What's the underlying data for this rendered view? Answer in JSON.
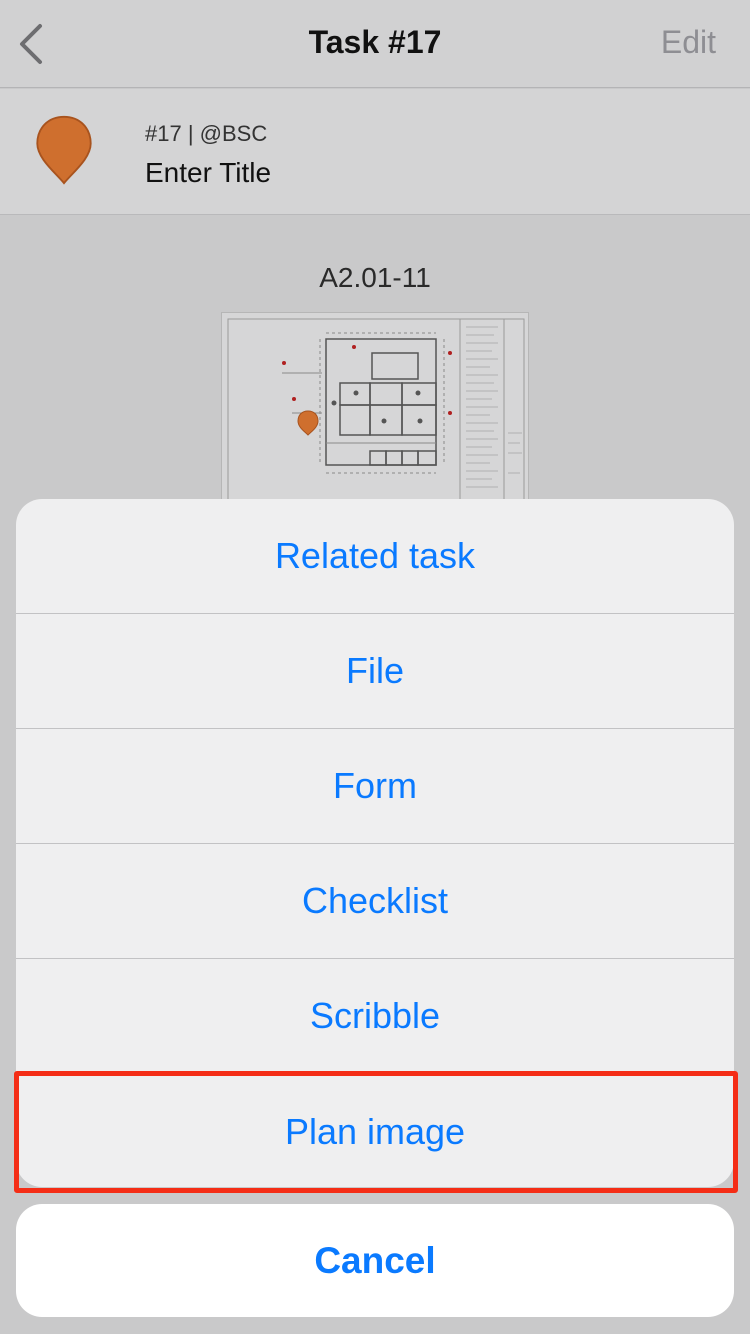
{
  "nav": {
    "back_icon": "chevron-left-icon",
    "title": "Task #17",
    "edit_label": "Edit"
  },
  "task": {
    "pin_icon": "map-pin-icon",
    "pin_color": "#cf6f2e",
    "meta": "#17 | @BSC",
    "title": "Enter Title"
  },
  "plan": {
    "label": "A2.01-11",
    "thumbnail": "floor-plan-drawing"
  },
  "action_sheet": {
    "items": [
      {
        "label": "Related task"
      },
      {
        "label": "File"
      },
      {
        "label": "Form"
      },
      {
        "label": "Checklist"
      },
      {
        "label": "Scribble"
      },
      {
        "label": "Plan image",
        "highlighted": true
      }
    ],
    "cancel_label": "Cancel",
    "accent_color": "#0a7aff",
    "highlight_color": "#f42d16"
  }
}
